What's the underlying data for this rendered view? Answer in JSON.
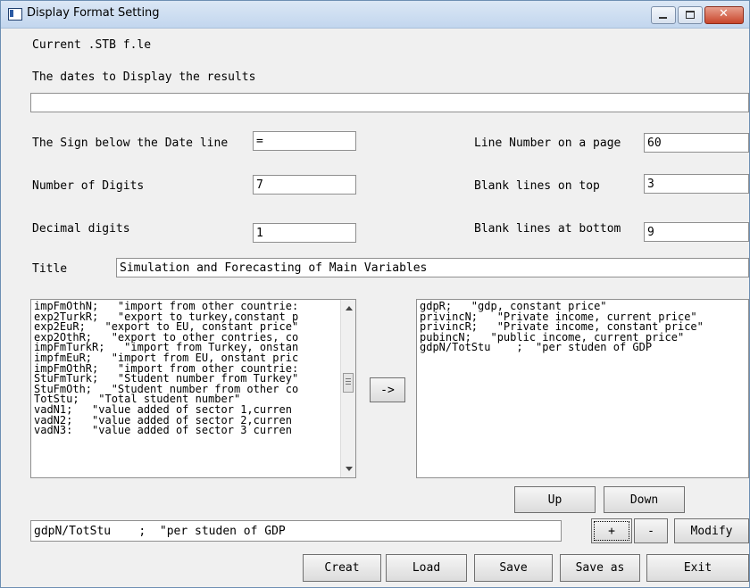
{
  "window": {
    "title": "Display Format Setting",
    "controls": {
      "minimize": "–",
      "maximize": "□",
      "close": "✕"
    }
  },
  "labels": {
    "current_file": "Current .STB f.le",
    "dates_to_display": "The dates to Display the results",
    "sign_below_date": "The Sign below the Date line",
    "number_of_digits": "Number of Digits",
    "decimal_digits": "Decimal digits",
    "line_number_on_page": "Line Number on a page",
    "blank_lines_top": "Blank lines on top",
    "blank_lines_bottom": "Blank lines at bottom",
    "title": "Title"
  },
  "fields": {
    "dates": "",
    "sign_below_date": "=",
    "number_of_digits": "7",
    "decimal_digits": "1",
    "line_number_on_page": "60",
    "blank_lines_top": "3",
    "blank_lines_bottom": "9",
    "title": "Simulation and Forecasting of Main Variables",
    "edit_line": "gdpN/TotStu    ;  \"per studen of GDP"
  },
  "available_vars": [
    "impFmOthN;   \"import from other countrie:",
    "exp2TurkR;   \"export to turkey,constant p",
    "exp2EuR;   \"export to EU, constant price\"",
    "exp2OthR;   \"export to other contries, co",
    "impFmTurkR;   \"import from Turkey, onstan",
    "impfmEuR;   \"import from EU, onstant pric",
    "impFmOthR;   \"import from other countrie:",
    "StuFmTurk;   \"Student number from Turkey\"",
    "StuFmOth;   \"Student number from other co",
    "TotStu;   \"Total student number\"",
    "vadN1;   \"value added of sector 1,curren",
    "vadN2;   \"value added of sector 2,curren",
    "vadN3:   \"value added of sector 3 curren"
  ],
  "selected_vars": [
    "gdpR;   \"gdp, constant price\"",
    "privincN;   \"Private income, current price\"",
    "privincR;   \"Private income, constant price\"",
    "pubincN;   \"public income, current price\"",
    "gdpN/TotStu    ;  \"per studen of GDP"
  ],
  "buttons": {
    "transfer": "->",
    "up": "Up",
    "down": "Down",
    "plus": "+",
    "minus": "-",
    "modify": "Modify",
    "creat": "Creat",
    "load": "Load",
    "save": "Save",
    "save_as": "Save as",
    "exit": "Exit"
  }
}
